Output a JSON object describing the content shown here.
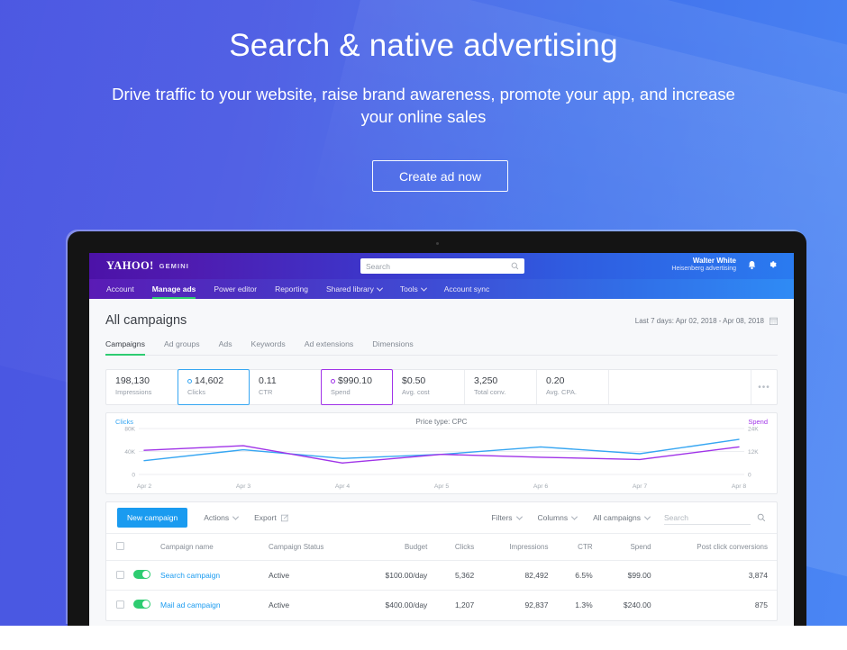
{
  "hero": {
    "title": "Search & native advertising",
    "subtitle": "Drive traffic to your website, raise brand awareness, promote your app, and increase your online sales",
    "cta_label": "Create ad now",
    "bg_left": "#4a56e2",
    "bg_right": "#4a86f4"
  },
  "brandbar": {
    "logo": "YAHOO!",
    "product": "GEMINI",
    "search_placeholder": "Search",
    "search_value": "",
    "user_name": "Walter White",
    "user_org": "Heisenberg advertising",
    "icons": [
      "search-icon",
      "bell-icon",
      "gear-icon"
    ]
  },
  "nav": {
    "items": [
      {
        "label": "Account",
        "active": false,
        "caret": false
      },
      {
        "label": "Manage ads",
        "active": true,
        "caret": false
      },
      {
        "label": "Power editor",
        "active": false,
        "caret": false
      },
      {
        "label": "Reporting",
        "active": false,
        "caret": false
      },
      {
        "label": "Shared library",
        "active": false,
        "caret": true
      },
      {
        "label": "Tools",
        "active": false,
        "caret": true
      },
      {
        "label": "Account sync",
        "active": false,
        "caret": false
      }
    ]
  },
  "page": {
    "title": "All campaigns",
    "date_range": "Last 7 days: Apr 02, 2018 - Apr 08, 2018",
    "subtabs": [
      {
        "label": "Campaigns",
        "active": true
      },
      {
        "label": "Ad groups",
        "active": false
      },
      {
        "label": "Ads",
        "active": false
      },
      {
        "label": "Keywords",
        "active": false
      },
      {
        "label": "Ad extensions",
        "active": false
      },
      {
        "label": "Dimensions",
        "active": false
      }
    ]
  },
  "kpis": [
    {
      "value": "198,130",
      "label": "Impressions",
      "selected": "none"
    },
    {
      "value": "14,602",
      "label": "Clicks",
      "selected": "blue"
    },
    {
      "value": "0.11",
      "label": "CTR",
      "selected": "none"
    },
    {
      "value": "$990.10",
      "label": "Spend",
      "selected": "purple"
    },
    {
      "value": "$0.50",
      "label": "Avg. cost",
      "selected": "none"
    },
    {
      "value": "3,250",
      "label": "Total conv.",
      "selected": "none"
    },
    {
      "value": "0.20",
      "label": "Avg. CPA.",
      "selected": "none"
    }
  ],
  "kpi_more_label": "•••",
  "chart_data": {
    "type": "line",
    "title": "",
    "annotation": "Price type: CPC",
    "legend_left": "Clicks",
    "legend_right": "Spend",
    "legend_position": "top-left and top-right",
    "grid": true,
    "categories": [
      "Apr 2",
      "Apr 3",
      "Apr 4",
      "Apr 5",
      "Apr 6",
      "Apr 7",
      "Apr 8"
    ],
    "left_axis": {
      "label": "Clicks",
      "ticks": [
        "80K",
        "40K",
        "0"
      ],
      "ylim": [
        0,
        80000
      ],
      "color": "#36a6f2"
    },
    "right_axis": {
      "label": "Spend",
      "ticks": [
        "24K",
        "12K",
        "0"
      ],
      "ylim": [
        0,
        24000
      ],
      "color": "#a033e8"
    },
    "series": [
      {
        "name": "Clicks",
        "color": "#36a6f2",
        "axis": "left",
        "values": [
          24000,
          43000,
          28000,
          35000,
          48000,
          36000,
          61000
        ]
      },
      {
        "name": "Spend",
        "color": "#a033e8",
        "axis": "right",
        "values": [
          12600,
          15000,
          6000,
          10500,
          9000,
          7800,
          14400
        ]
      }
    ]
  },
  "table_toolbar": {
    "new_campaign": "New campaign",
    "actions": "Actions",
    "export": "Export",
    "filters": "Filters",
    "columns": "Columns",
    "scope": "All campaigns",
    "search_placeholder": "Search",
    "search_value": ""
  },
  "table": {
    "columns": [
      "Campaign name",
      "Campaign Status",
      "Budget",
      "Clicks",
      "Impressions",
      "CTR",
      "Spend",
      "Post click conversions"
    ],
    "rows": [
      {
        "name": "Search campaign",
        "status": "Active",
        "budget": "$100.00/day",
        "clicks": "5,362",
        "impressions": "82,492",
        "ctr": "6.5%",
        "spend": "$99.00",
        "conversions": "3,874",
        "enabled": true
      },
      {
        "name": "Mail ad campaign",
        "status": "Active",
        "budget": "$400.00/day",
        "clicks": "1,207",
        "impressions": "92,837",
        "ctr": "1.3%",
        "spend": "$240.00",
        "conversions": "875",
        "enabled": true
      }
    ]
  }
}
